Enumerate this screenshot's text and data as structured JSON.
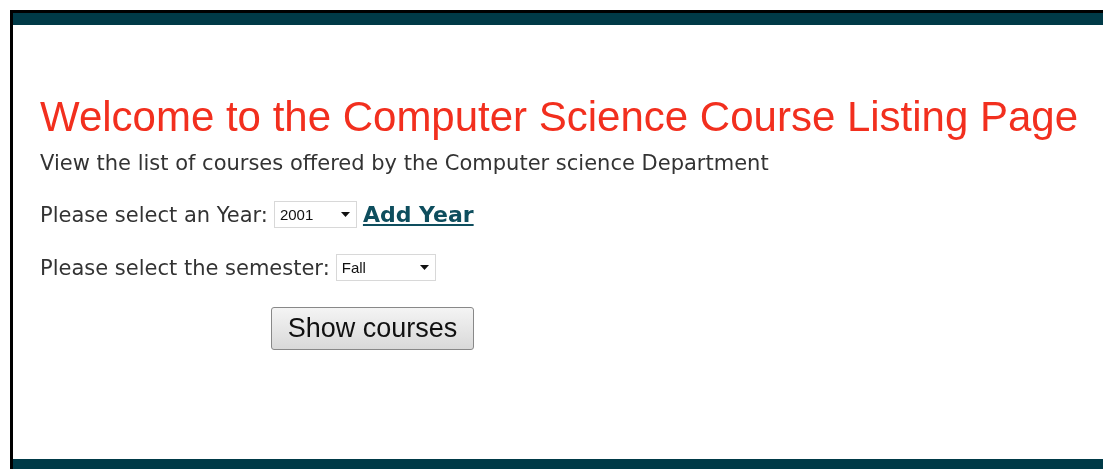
{
  "heading": "Welcome to the Computer Science Course Listing Page",
  "intro": "View the list of courses offered by the Computer science Department",
  "year": {
    "label": "Please select an Year:",
    "value": "2001",
    "link": "Add Year"
  },
  "semester": {
    "label": "Please select the semester:",
    "value": "Fall"
  },
  "button": "Show courses"
}
